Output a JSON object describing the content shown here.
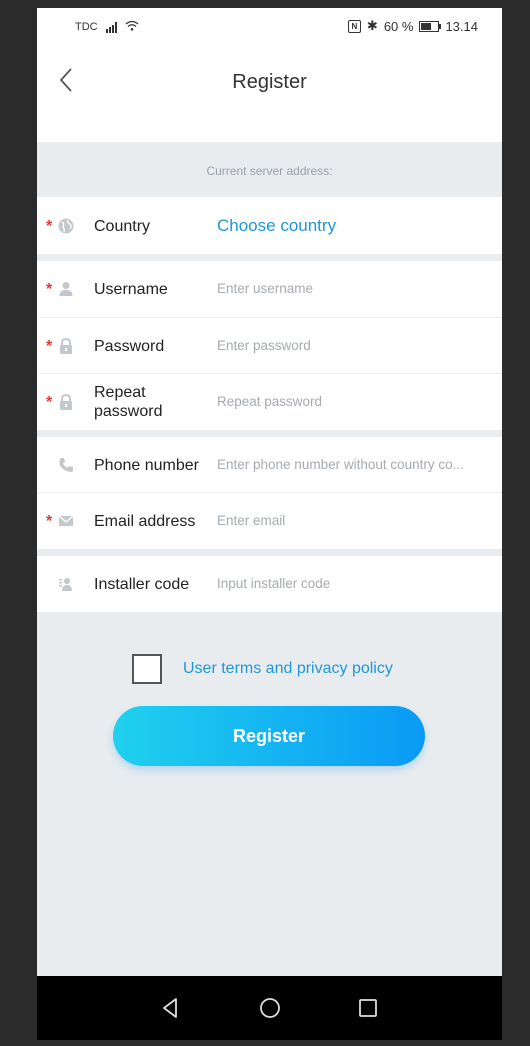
{
  "status_bar": {
    "carrier": "TDC",
    "nfc": "N",
    "bluetooth": "✱",
    "battery": "60 %",
    "time": "13.14"
  },
  "header": {
    "title": "Register"
  },
  "server": {
    "label": "Current server address:"
  },
  "form": {
    "country": {
      "label": "Country",
      "value": "Choose country",
      "required": true,
      "icon": "globe-icon"
    },
    "username": {
      "label": "Username",
      "placeholder": "Enter username",
      "required": true,
      "icon": "person-icon"
    },
    "password": {
      "label": "Password",
      "placeholder": "Enter password",
      "required": true,
      "icon": "lock-icon"
    },
    "repeat_password": {
      "label_line1": "Repeat",
      "label_line2": "password",
      "placeholder": "Repeat password",
      "required": true,
      "icon": "lock-icon"
    },
    "phone": {
      "label": "Phone number",
      "placeholder": "Enter phone number without country co...",
      "required": false,
      "icon": "phone-icon"
    },
    "email": {
      "label": "Email address",
      "placeholder": "Enter email",
      "required": true,
      "icon": "mail-icon"
    },
    "installer": {
      "label": "Installer code",
      "placeholder": "Input installer code",
      "required": false,
      "icon": "id-card-icon"
    },
    "required_mark": "*"
  },
  "terms": {
    "label": "User terms and privacy policy",
    "checked": false
  },
  "actions": {
    "register_label": "Register"
  },
  "colors": {
    "accent": "#1e96d8",
    "required": "#e53935",
    "button_start": "#20d1ee",
    "button_end": "#0a9af5",
    "background": "#e8ecef"
  }
}
